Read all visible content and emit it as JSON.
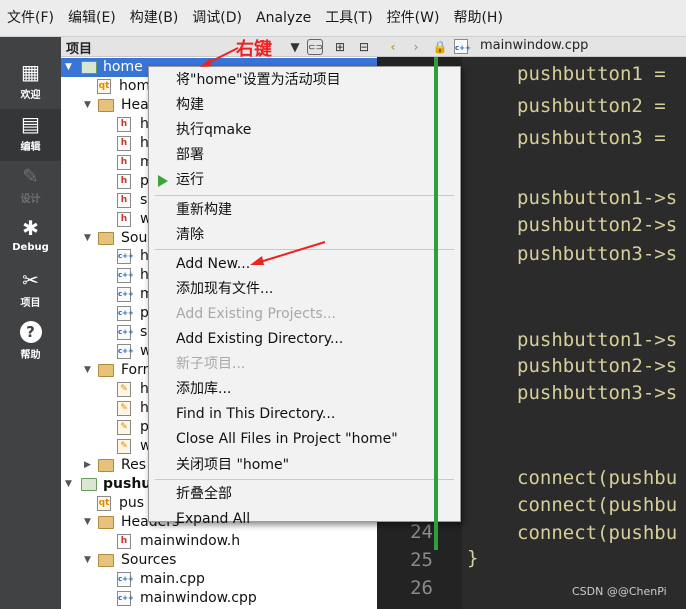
{
  "menubar": {
    "items": [
      "文件(F)",
      "编辑(E)",
      "构建(B)",
      "调试(D)",
      "Analyze",
      "工具(T)",
      "控件(W)",
      "帮助(H)"
    ]
  },
  "modes": [
    {
      "label": "欢迎",
      "icon": "grid-icon"
    },
    {
      "label": "编辑",
      "icon": "document-icon"
    },
    {
      "label": "设计",
      "icon": "pencil-icon"
    },
    {
      "label": "Debug",
      "icon": "bug-icon"
    },
    {
      "label": "项目",
      "icon": "wrench-icon"
    },
    {
      "label": "帮助",
      "icon": "help-icon"
    }
  ],
  "project_panel": {
    "title": "项目"
  },
  "tree": [
    {
      "text": "home",
      "kind": "project",
      "arrow": "▼",
      "selected": true
    },
    {
      "text": "hom",
      "kind": "profile"
    },
    {
      "text": "Hea",
      "kind": "folder",
      "arrow": "▼"
    },
    {
      "text": "h",
      "kind": "h"
    },
    {
      "text": "h",
      "kind": "h"
    },
    {
      "text": "m",
      "kind": "h"
    },
    {
      "text": "p",
      "kind": "h"
    },
    {
      "text": "s",
      "kind": "h"
    },
    {
      "text": "w",
      "kind": "h"
    },
    {
      "text": "Sou",
      "kind": "folder",
      "arrow": "▼"
    },
    {
      "text": "h",
      "kind": "cpp"
    },
    {
      "text": "h",
      "kind": "cpp"
    },
    {
      "text": "m",
      "kind": "cpp"
    },
    {
      "text": "p",
      "kind": "cpp"
    },
    {
      "text": "s",
      "kind": "cpp"
    },
    {
      "text": "w",
      "kind": "cpp"
    },
    {
      "text": "Forr",
      "kind": "folder",
      "arrow": "▼"
    },
    {
      "text": "h",
      "kind": "ui"
    },
    {
      "text": "h",
      "kind": "ui"
    },
    {
      "text": "p",
      "kind": "ui"
    },
    {
      "text": "w",
      "kind": "ui"
    },
    {
      "text": "Res",
      "kind": "folder",
      "arrow": "▶"
    },
    {
      "text": "pushu",
      "kind": "project",
      "arrow": "▼",
      "bold": true
    },
    {
      "text": "pus",
      "kind": "profile"
    },
    {
      "text": "Headers",
      "kind": "folder",
      "arrow": "▼"
    },
    {
      "text": "mainwindow.h",
      "kind": "h"
    },
    {
      "text": "Sources",
      "kind": "folder",
      "arrow": "▼"
    },
    {
      "text": "main.cpp",
      "kind": "cpp"
    },
    {
      "text": "mainwindow.cpp",
      "kind": "cpp"
    }
  ],
  "editor": {
    "filename": "mainwindow.cpp",
    "line_numbers": [
      "24",
      "25",
      "26"
    ],
    "code_lines": [
      "pushbutton1 =",
      "pushbutton2 =",
      "pushbutton3 =",
      "",
      "pushbutton1->s",
      "pushbutton2->s",
      "pushbutton3->s",
      "",
      "",
      "pushbutton1->s",
      "pushbutton2->s",
      "pushbutton3->s",
      "",
      "",
      "connect(pushbu",
      "connect(pushbu",
      "connect(pushbu",
      "}"
    ],
    "code_color": "#d6cf9a"
  },
  "context_menu": {
    "items": [
      {
        "label": "将\"home\"设置为活动项目"
      },
      {
        "label": "构建"
      },
      {
        "label": "执行qmake"
      },
      {
        "label": "部署"
      },
      {
        "label": "运行",
        "icon": "play-icon"
      },
      {
        "sep": true
      },
      {
        "label": "重新构建"
      },
      {
        "label": "清除"
      },
      {
        "sep": true
      },
      {
        "label": "Add New..."
      },
      {
        "label": "添加现有文件..."
      },
      {
        "label": "Add Existing Projects...",
        "disabled": true
      },
      {
        "label": "Add Existing Directory..."
      },
      {
        "label": "新子项目...",
        "disabled": true
      },
      {
        "label": "添加库..."
      },
      {
        "label": "Find in This Directory..."
      },
      {
        "label": "Close All Files in Project \"home\""
      },
      {
        "label": "关闭项目 \"home\""
      },
      {
        "sep": true
      },
      {
        "label": "折叠全部"
      },
      {
        "label": "Expand All"
      }
    ]
  },
  "annotation": {
    "text": "右键",
    "color": "#ee2222"
  },
  "watermark": "CSDN @@ChenPi"
}
